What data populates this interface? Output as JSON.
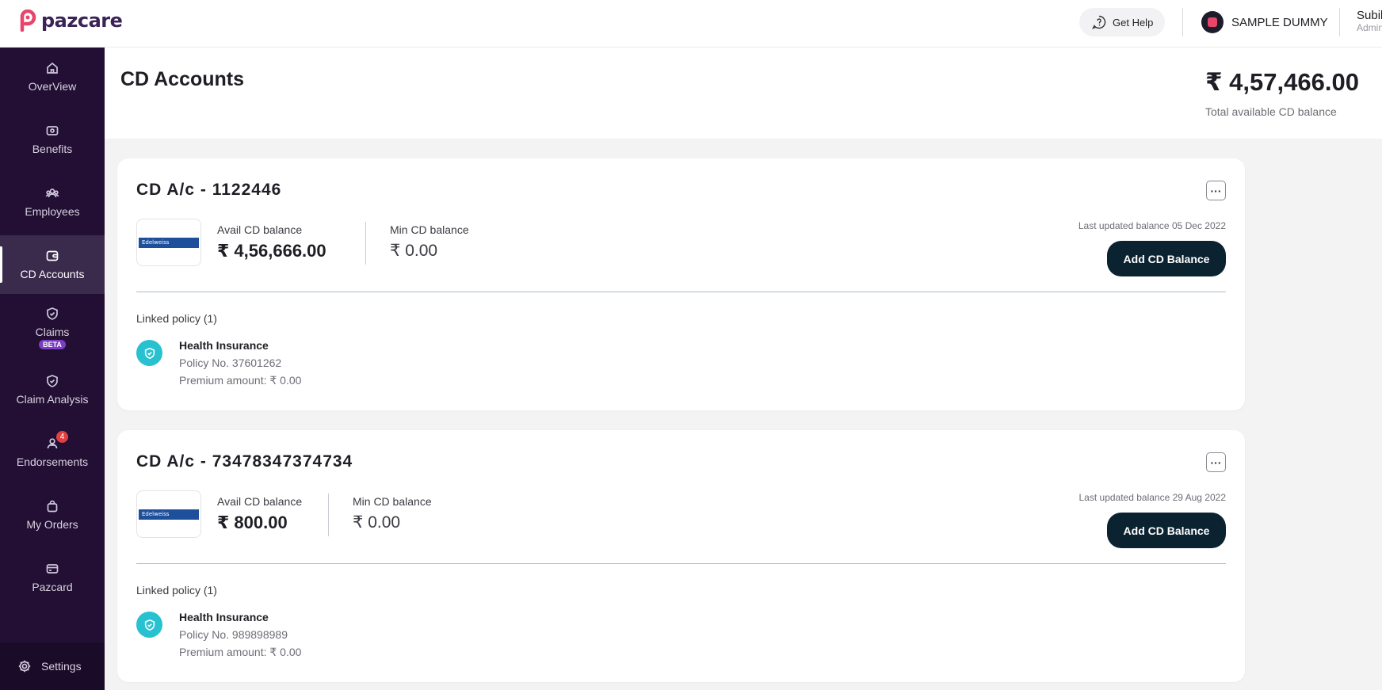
{
  "header": {
    "logo_text": "pazcare",
    "help_label": "Get Help",
    "user_name": "SAMPLE DUMMY",
    "account_name": "Subil",
    "account_role": "Admin"
  },
  "sidebar": {
    "items": [
      {
        "label": "OverView",
        "icon": "home-icon"
      },
      {
        "label": "Benefits",
        "icon": "benefits-icon"
      },
      {
        "label": "Employees",
        "icon": "people-icon"
      },
      {
        "label": "CD Accounts",
        "icon": "wallet-icon",
        "active": true
      },
      {
        "label": "Claims",
        "icon": "shield-check-icon",
        "tag": "BETA"
      },
      {
        "label": "Claim Analysis",
        "icon": "shield-check-icon"
      },
      {
        "label": "Endorsements",
        "icon": "user-endorse-icon",
        "badge": "4"
      },
      {
        "label": "My Orders",
        "icon": "bag-icon"
      },
      {
        "label": "Pazcard",
        "icon": "card-icon"
      }
    ],
    "settings_label": "Settings"
  },
  "page": {
    "title": "CD Accounts",
    "total_balance": "₹ 4,57,466.00",
    "total_balance_label": "Total available CD balance"
  },
  "accounts": [
    {
      "title": "CD A/c - 1122446",
      "bank": "Edelweiss",
      "avail_label": "Avail CD balance",
      "avail_value": "₹ 4,56,666.00",
      "min_label": "Min CD balance",
      "min_value": "₹ 0.00",
      "updated": "Last updated balance 05 Dec 2022",
      "add_label": "Add CD Balance",
      "linked_label": "Linked policy (1)",
      "policy": {
        "name": "Health Insurance",
        "number": "Policy No. 37601262",
        "premium": "Premium amount: ₹ 0.00"
      }
    },
    {
      "title": "CD A/c - 73478347374734",
      "bank": "Edelweiss",
      "avail_label": "Avail CD balance",
      "avail_value": "₹ 800.00",
      "min_label": "Min CD balance",
      "min_value": "₹ 0.00",
      "updated": "Last updated balance 29 Aug 2022",
      "add_label": "Add CD Balance",
      "linked_label": "Linked policy (1)",
      "policy": {
        "name": "Health Insurance",
        "number": "Policy No. 989898989",
        "premium": "Premium amount: ₹ 0.00"
      }
    }
  ],
  "colors": {
    "sidebar_bg": "#220f33",
    "sidebar_active": "#3a2a4b",
    "primary_button": "#0b2230",
    "policy_icon": "#27c1cf",
    "brand": "#e9446a"
  }
}
